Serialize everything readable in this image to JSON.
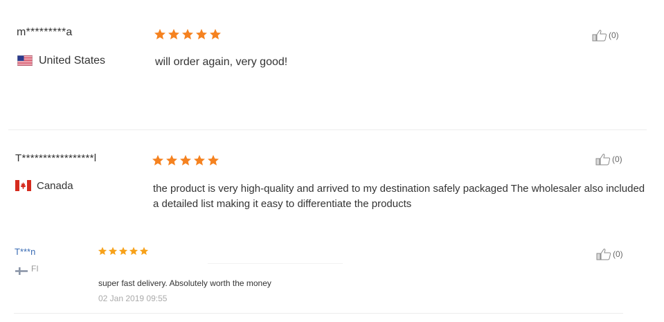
{
  "reviews": [
    {
      "name": "m*********a",
      "country": "United States",
      "flag_icon": "us-flag-icon",
      "rating": 5,
      "text": "will order again, very good!",
      "helpful_count": "(0)"
    },
    {
      "name": "T*****************l",
      "country": "Canada",
      "flag_icon": "canada-flag-icon",
      "rating": 5,
      "text": "the product is very high-quality and arrived to my destination safely packaged The wholesaler also included a detailed list making it easy to differentiate the products",
      "helpful_count": "(0)"
    },
    {
      "name": "T***n",
      "country": "FI",
      "flag_icon": "finland-flag-icon",
      "rating": 5,
      "text": "super fast delivery. Absolutely worth the money",
      "date": "02 Jan 2019 09:55",
      "helpful_count": "(0)"
    }
  ],
  "colors": {
    "star_orange": "#f58220",
    "star_yellow": "#f7a21b",
    "reviewer_link": "#3a6cb4",
    "text": "#333333",
    "muted": "#aaaaaa",
    "divider": "#ececec"
  },
  "icons": {
    "star": "star-icon",
    "helpful": "thumbs-up-icon"
  }
}
